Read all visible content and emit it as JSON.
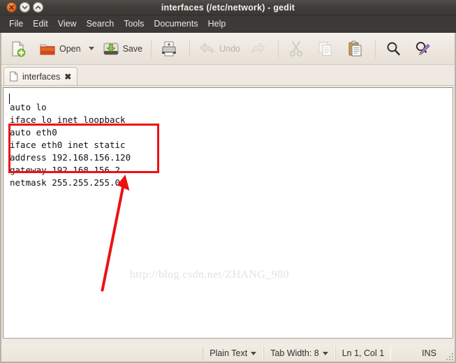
{
  "window": {
    "title": "interfaces (/etc/network) - gedit",
    "controls": [
      {
        "name": "close",
        "glyph": "x"
      },
      {
        "name": "minimize",
        "glyph": "v"
      },
      {
        "name": "maximize",
        "glyph": "^"
      }
    ]
  },
  "menubar": {
    "items": [
      {
        "label": "File"
      },
      {
        "label": "Edit"
      },
      {
        "label": "View"
      },
      {
        "label": "Search"
      },
      {
        "label": "Tools"
      },
      {
        "label": "Documents"
      },
      {
        "label": "Help"
      }
    ]
  },
  "toolbar": {
    "new_label": "",
    "open_label": "Open",
    "save_label": "Save",
    "print_label": "",
    "undo_label": "Undo",
    "redo_label": "",
    "cut_label": "",
    "copy_label": "",
    "paste_label": "",
    "find_label": "",
    "replace_label": ""
  },
  "tabs": [
    {
      "label": "interfaces",
      "close_glyph": "✖"
    }
  ],
  "editor": {
    "lines": [
      "auto lo",
      "iface lo inet loopback",
      "auto eth0",
      "iface eth0 inet static",
      "address 192.168.156.120",
      "gateway 192.168.156.2",
      "netmask 255.255.255.0"
    ],
    "text": "auto lo\niface lo inet loopback\nauto eth0\niface eth0 inet static\naddress 192.168.156.120\ngateway 192.168.156.2\nnetmask 255.255.255.0",
    "watermark": "http://blog.csdn.net/ZHANG_980"
  },
  "annotations": {
    "highlight_color": "#ee1111",
    "highlighted_lines": [
      "iface eth0 inet static",
      "address 192.168.156.120",
      "gateway 192.168.156.2",
      "netmask 255.255.255.0"
    ]
  },
  "statusbar": {
    "language": "Plain Text",
    "tab_width": "Tab Width: 8",
    "position": "Ln 1, Col 1",
    "insert_mode": "INS"
  },
  "colors": {
    "titlebar": "#3c3a36",
    "toolbar": "#ece6de",
    "editor_bg": "#ffffff",
    "accent_orange": "#e06826",
    "annotation_red": "#ee1111"
  }
}
